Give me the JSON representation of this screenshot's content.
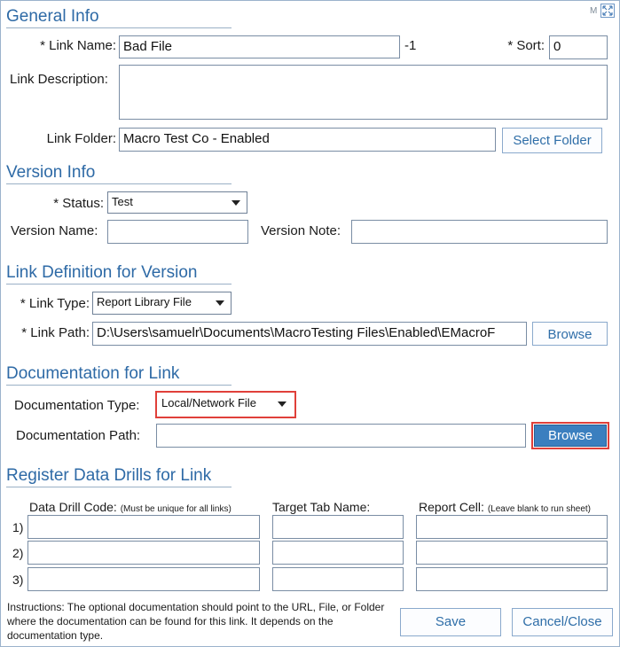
{
  "corner": {
    "m_label": "M",
    "expand_icon": "expand-arrows-icon"
  },
  "general_info": {
    "title": "General Info",
    "link_name_label": "* Link Name:",
    "link_name_value": "Bad File",
    "link_id": "-1",
    "sort_label": "* Sort:",
    "sort_value": "0",
    "link_description_label": "Link Description:",
    "link_description_value": "",
    "link_folder_label": "Link Folder:",
    "link_folder_value": "Macro Test Co - Enabled",
    "select_folder_button": "Select Folder"
  },
  "version_info": {
    "title": "Version Info",
    "status_label": "* Status:",
    "status_value": "Test",
    "version_name_label": "Version Name:",
    "version_name_value": "",
    "version_note_label": "Version Note:",
    "version_note_value": ""
  },
  "link_definition": {
    "title": "Link Definition for Version",
    "link_type_label": "* Link Type:",
    "link_type_value": "Report Library File",
    "link_path_label": "* Link Path:",
    "link_path_value": "D:\\Users\\samuelr\\Documents\\MacroTesting Files\\Enabled\\EMacroF",
    "browse_button": "Browse"
  },
  "documentation": {
    "title": "Documentation for Link",
    "doc_type_label": "Documentation Type:",
    "doc_type_value": "Local/Network File",
    "doc_path_label": "Documentation Path:",
    "doc_path_value": "",
    "browse_button": "Browse"
  },
  "data_drills": {
    "title": "Register Data Drills for Link",
    "code_header": "Data Drill Code:",
    "code_note": "(Must be unique for all links)",
    "tab_header": "Target Tab Name:",
    "cell_header": "Report Cell:",
    "cell_note": "(Leave blank to run sheet)",
    "rows": [
      {
        "num": "1)",
        "code": "",
        "tab": "",
        "cell": ""
      },
      {
        "num": "2)",
        "code": "",
        "tab": "",
        "cell": ""
      },
      {
        "num": "3)",
        "code": "",
        "tab": "",
        "cell": ""
      }
    ]
  },
  "footer": {
    "instructions": "Instructions: The optional documentation should point to the URL, File, or Folder where the documentation can be found for this link. It depends on the documentation type.",
    "save_button": "Save",
    "cancel_button": "Cancel/Close"
  }
}
